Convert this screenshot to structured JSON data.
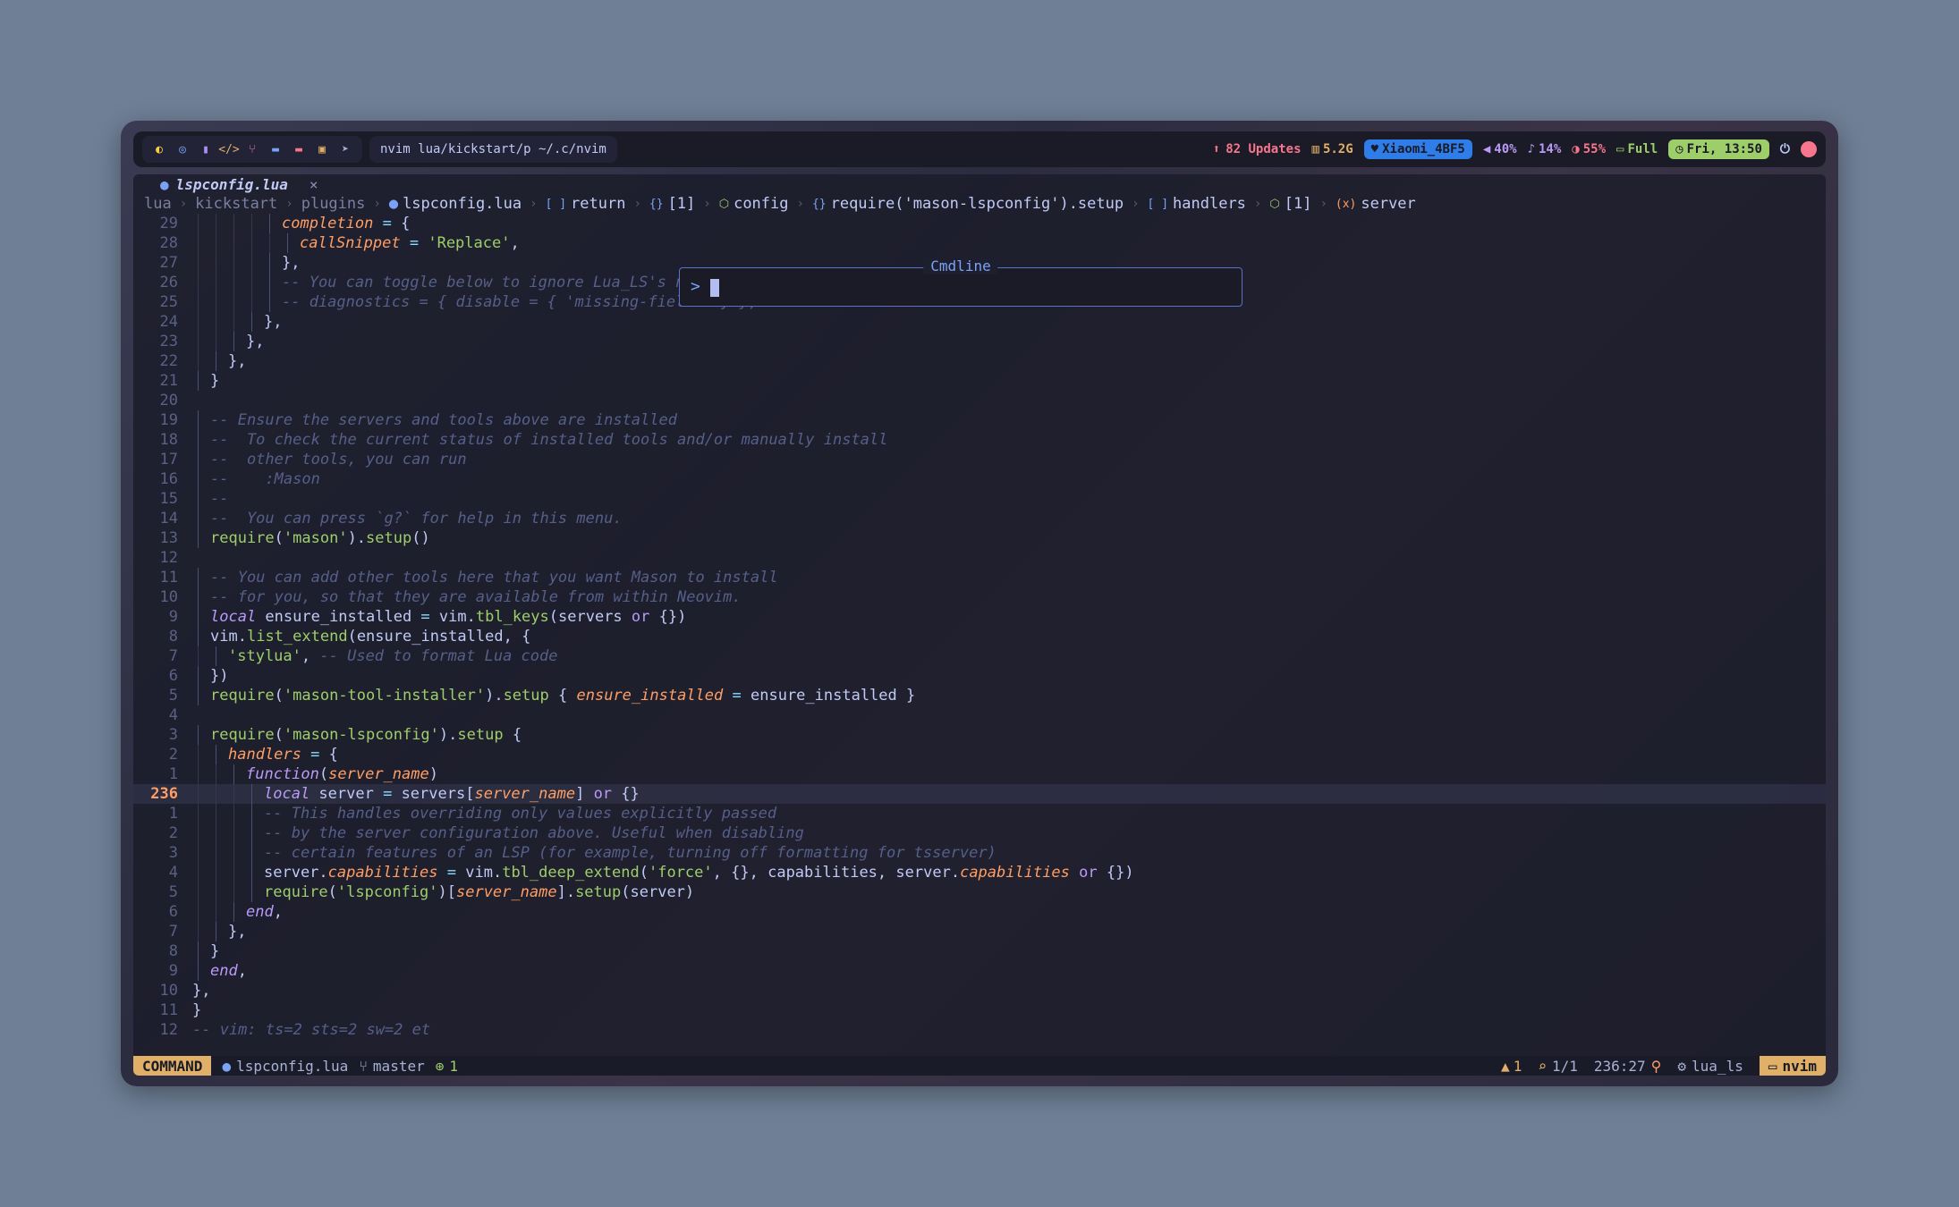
{
  "bar": {
    "workspace_icons": [
      {
        "name": "yellow-circle-icon",
        "glyph": "◐",
        "color": "#f5d142"
      },
      {
        "name": "target-icon",
        "glyph": "◎",
        "color": "#7aa2f7"
      },
      {
        "name": "file-icon",
        "glyph": "▮",
        "color": "#a98ff0"
      },
      {
        "name": "code-icon",
        "glyph": "</>",
        "color": "#e0af68"
      },
      {
        "name": "git-icon",
        "glyph": "⑂",
        "color": "#f7768e"
      },
      {
        "name": "folder-icon",
        "glyph": "▬",
        "color": "#7aa2f7"
      },
      {
        "name": "mail-icon",
        "glyph": "▬",
        "color": "#f7768e"
      },
      {
        "name": "chat-icon",
        "glyph": "▣",
        "color": "#e0af68"
      },
      {
        "name": "send-icon",
        "glyph": "➤",
        "color": "#a9b1d6"
      }
    ],
    "window_title": "nvim lua/kickstart/p ~/.c/nvim",
    "updates": "82 Updates",
    "memory": "5.2G",
    "wifi": "Xiaomi_4BF5",
    "volume": "40%",
    "mic": "14%",
    "brightness": "55%",
    "battery": "Full",
    "clock": "Fri, 13:50",
    "colors": {
      "updates": "#f7768e",
      "memory": "#e0af68",
      "wifi_bg": "#2e7de9",
      "volume": "#bb9af7",
      "mic": "#bb9af7",
      "brightness": "#f7768e",
      "battery": "#9ece6a",
      "clock_bg": "#9ece6a"
    }
  },
  "tab": {
    "name": "lspconfig.lua",
    "close": "×"
  },
  "winbar": {
    "path": [
      "lua",
      "kickstart",
      "plugins"
    ],
    "file": "lspconfig.lua",
    "symbols": [
      {
        "icon": "[ ]",
        "label": "return"
      },
      {
        "icon": "{}",
        "label": "[1]"
      },
      {
        "icon": "⬡",
        "label": "config"
      },
      {
        "icon": "{}",
        "label": "require('mason-lspconfig').setup"
      },
      {
        "icon": "[ ]",
        "label": "handlers"
      },
      {
        "icon": "⬡",
        "label": "[1]"
      },
      {
        "icon": "(x)",
        "label": "server"
      }
    ]
  },
  "cmdline": {
    "title": "Cmdline",
    "prompt": ">"
  },
  "code_lines": [
    {
      "ln": "29",
      "indent": 5,
      "html": "<span class='fld'>completion</span> <span class='op'>=</span> <span class='br'>{</span>"
    },
    {
      "ln": "28",
      "indent": 6,
      "html": "<span class='fld'>callSnippet</span> <span class='op'>=</span> <span class='s'>'Replace'</span><span class='br'>,</span>"
    },
    {
      "ln": "27",
      "indent": 5,
      "html": "<span class='br'>},</span>"
    },
    {
      "ln": "26",
      "indent": 5,
      "html": "<span class='c'>-- You can toggle below to ignore Lua_LS's noisy `missing-fields` warnings</span>"
    },
    {
      "ln": "25",
      "indent": 5,
      "html": "<span class='c'>-- diagnostics = { disable = { 'missing-fields' } },</span>"
    },
    {
      "ln": "24",
      "indent": 4,
      "html": "<span class='br'>},</span>"
    },
    {
      "ln": "23",
      "indent": 3,
      "html": "<span class='br'>},</span>"
    },
    {
      "ln": "22",
      "indent": 2,
      "html": "<span class='br'>},</span>"
    },
    {
      "ln": "21",
      "indent": 1,
      "html": "<span class='br'>}</span>"
    },
    {
      "ln": "20",
      "indent": 0,
      "html": ""
    },
    {
      "ln": "19",
      "indent": 1,
      "html": "<span class='c'>-- Ensure the servers and tools above are installed</span>"
    },
    {
      "ln": "18",
      "indent": 1,
      "html": "<span class='c'>--  To check the current status of installed tools and/or manually install</span>"
    },
    {
      "ln": "17",
      "indent": 1,
      "html": "<span class='c'>--  other tools, you can run</span>"
    },
    {
      "ln": "16",
      "indent": 1,
      "html": "<span class='c'>--    :Mason</span>"
    },
    {
      "ln": "15",
      "indent": 1,
      "html": "<span class='c'>--</span>"
    },
    {
      "ln": "14",
      "indent": 1,
      "html": "<span class='c'>--  You can press `g?` for help in this menu.</span>"
    },
    {
      "ln": "13",
      "indent": 1,
      "html": "<span class='fn'>require</span><span class='br'>(</span><span class='s'>'mason'</span><span class='br'>).</span><span class='fn'>setup</span><span class='br'>()</span>"
    },
    {
      "ln": "12",
      "indent": 0,
      "html": ""
    },
    {
      "ln": "11",
      "indent": 1,
      "html": "<span class='c'>-- You can add other tools here that you want Mason to install</span>"
    },
    {
      "ln": "10",
      "indent": 1,
      "html": "<span class='c'>-- for you, so that they are available from within Neovim.</span>"
    },
    {
      "ln": "9",
      "indent": 1,
      "html": "<span class='k'>local</span> ensure_installed <span class='op'>=</span> vim<span class='br'>.</span><span class='fn'>tbl_keys</span><span class='br'>(</span>servers <span class='kw'>or</span> <span class='br'>{})</span>"
    },
    {
      "ln": "8",
      "indent": 1,
      "html": "vim<span class='br'>.</span><span class='fn'>list_extend</span><span class='br'>(</span>ensure_installed<span class='br'>,</span> <span class='br'>{</span>"
    },
    {
      "ln": "7",
      "indent": 2,
      "html": "<span class='s'>'stylua'</span><span class='br'>,</span> <span class='c'>-- Used to format Lua code</span>"
    },
    {
      "ln": "6",
      "indent": 1,
      "html": "<span class='br'>})</span>"
    },
    {
      "ln": "5",
      "indent": 1,
      "html": "<span class='fn'>require</span><span class='br'>(</span><span class='s'>'mason-tool-installer'</span><span class='br'>).</span><span class='fn'>setup</span> <span class='br'>{</span> <span class='fld'>ensure_installed</span> <span class='op'>=</span> ensure_installed <span class='br'>}</span>"
    },
    {
      "ln": "4",
      "indent": 0,
      "html": ""
    },
    {
      "ln": "3",
      "indent": 1,
      "html": "<span class='fn'>require</span><span class='br'>(</span><span class='s'>'mason-lspconfig'</span><span class='br'>).</span><span class='fn'>setup</span> <span class='br'>{</span>"
    },
    {
      "ln": "2",
      "indent": 2,
      "html": "<span class='fld'>handlers</span> <span class='op'>=</span> <span class='br'>{</span>"
    },
    {
      "ln": "1",
      "indent": 3,
      "html": "<span class='k'>function</span><span class='br'>(</span><span class='p'>server_name</span><span class='br'>)</span>"
    },
    {
      "ln": "236",
      "indent": 4,
      "current": true,
      "html": "<span class='k'>local</span> server <span class='op'>=</span> servers<span class='br'>[</span><span class='p'>server_name</span><span class='br'>]</span> <span class='kw'>or</span> <span class='br'>{}</span>"
    },
    {
      "ln": "1",
      "indent": 4,
      "html": "<span class='c'>-- This handles overriding only values explicitly passed</span>"
    },
    {
      "ln": "2",
      "indent": 4,
      "html": "<span class='c'>-- by the server configuration above. Useful when disabling</span>"
    },
    {
      "ln": "3",
      "indent": 4,
      "html": "<span class='c'>-- certain features of an LSP (for example, turning off formatting for tsserver)</span>"
    },
    {
      "ln": "4",
      "indent": 4,
      "html": "server<span class='br'>.</span><span class='fld'>capabilities</span> <span class='op'>=</span> vim<span class='br'>.</span><span class='fn'>tbl_deep_extend</span><span class='br'>(</span><span class='s'>'force'</span><span class='br'>,</span> <span class='br'>{},</span> capabilities<span class='br'>,</span> server<span class='br'>.</span><span class='fld'>capabilities</span> <span class='kw'>or</span> <span class='br'>{})</span>"
    },
    {
      "ln": "5",
      "indent": 4,
      "html": "<span class='fn'>require</span><span class='br'>(</span><span class='s'>'lspconfig'</span><span class='br'>)[</span><span class='p'>server_name</span><span class='br'>].</span><span class='fn'>setup</span><span class='br'>(</span>server<span class='br'>)</span>"
    },
    {
      "ln": "6",
      "indent": 3,
      "html": "<span class='k'>end</span><span class='br'>,</span>"
    },
    {
      "ln": "7",
      "indent": 2,
      "html": "<span class='br'>},</span>"
    },
    {
      "ln": "8",
      "indent": 1,
      "html": "<span class='br'>}</span>"
    },
    {
      "ln": "9",
      "indent": 1,
      "html": "<span class='k'>end</span><span class='br'>,</span>",
      "shift": -1
    },
    {
      "ln": "10",
      "indent": 0,
      "html": "<span class='br'>},</span>",
      "shift": 1
    },
    {
      "ln": "11",
      "indent": 0,
      "html": "<span class='br'>}</span>"
    },
    {
      "ln": "12",
      "indent": 0,
      "html": "<span class='c'>-- vim: ts=2 sts=2 sw=2 et</span>"
    }
  ],
  "status": {
    "mode": "COMMAND",
    "file": "lspconfig.lua",
    "branch": "master",
    "diff_added": "1",
    "warnings": "1",
    "search": "1/1",
    "position": "236:27",
    "lsp": "lua_ls",
    "cwd": "nvim"
  }
}
